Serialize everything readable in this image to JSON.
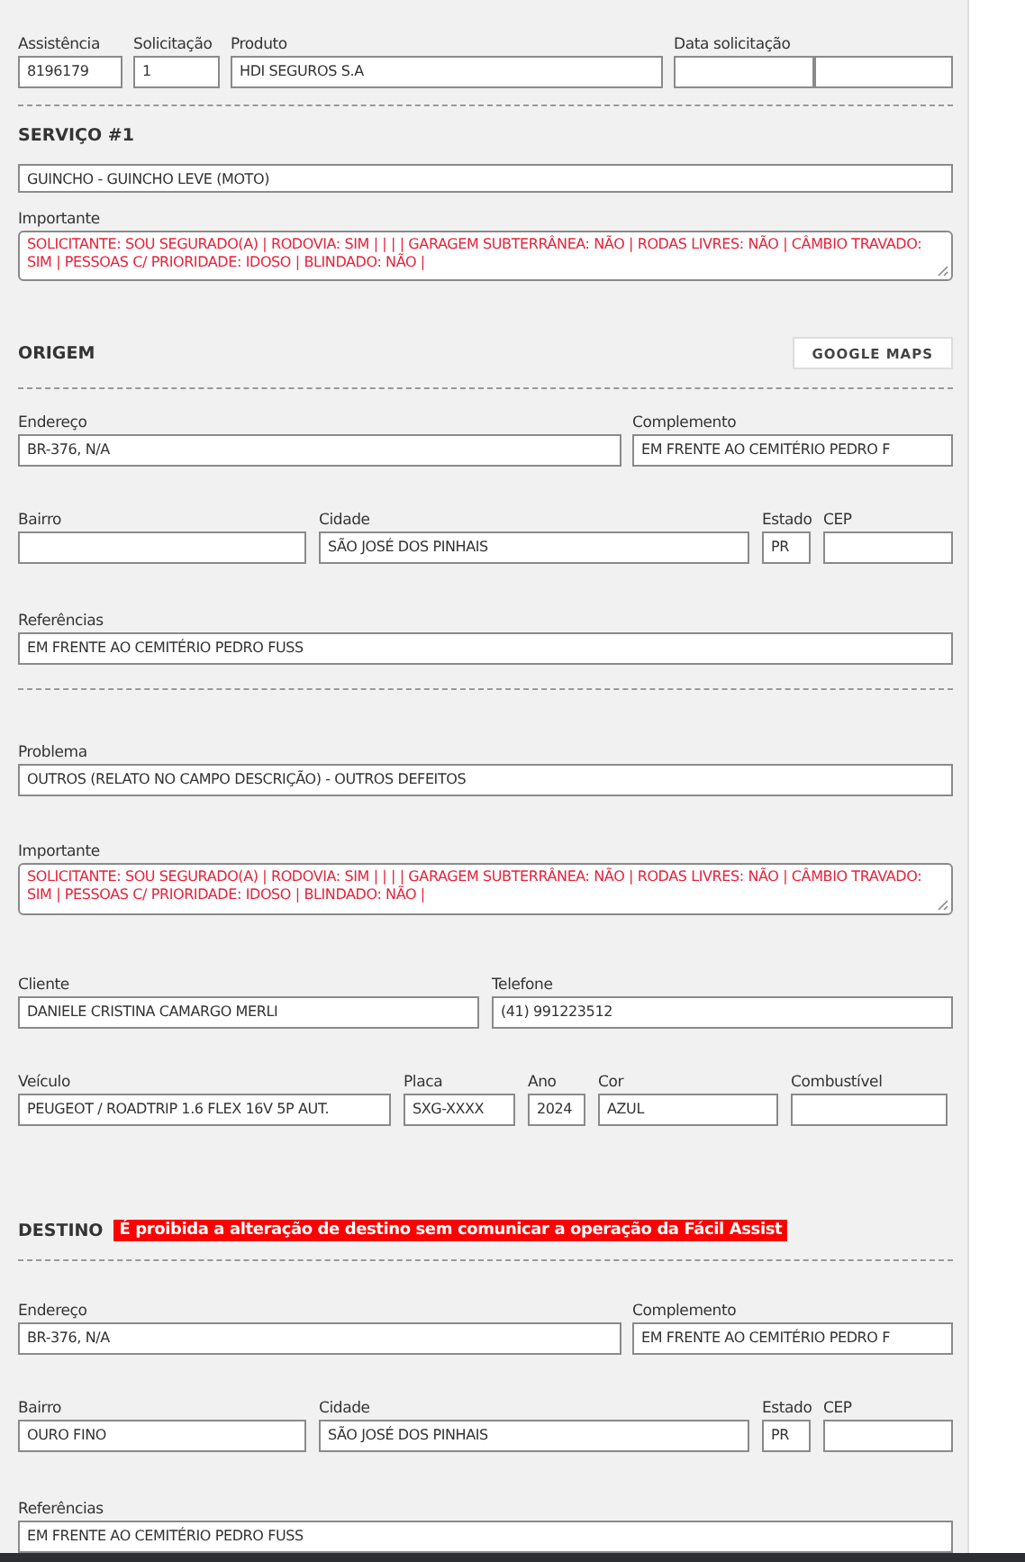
{
  "header": {
    "fields": [
      {
        "kind": "single",
        "label": "Assistência",
        "value": "8196179"
      },
      {
        "kind": "single",
        "label": "Solicitação",
        "value": "1"
      },
      {
        "kind": "single",
        "label": "Produto",
        "value": "HDI SEGUROS S.A"
      },
      {
        "kind": "split",
        "label": "Data solicitação"
      }
    ]
  },
  "servico": {
    "title": "SERVIÇO #1",
    "service": "GUINCHO - GUINCHO LEVE (MOTO)",
    "important_label": "Importante",
    "important_text": "SOLICITANTE: SOU SEGURADO(A) | RODOVIA: SIM |  |  |  | GARAGEM SUBTERRÂNEA: NÃO | RODAS LIVRES: NÃO | CÂMBIO TRAVADO: SIM | PESSOAS C/ PRIORIDADE: IDOSO | BLINDADO: NÃO |"
  },
  "origem": {
    "title": "ORIGEM",
    "maps_button": "GOOGLE MAPS",
    "address": {
      "endereco": {
        "label": "Endereço",
        "value": "BR-376, N/A"
      },
      "complemento": {
        "label": "Complemento",
        "value": "EM FRENTE AO CEMITÉRIO PEDRO F"
      },
      "bairro": {
        "label": "Bairro"
      },
      "cidade": {
        "label": "Cidade",
        "value": "SÃO JOSÉ DOS PINHAIS"
      },
      "estado": {
        "label": "Estado",
        "value": "PR"
      },
      "cep": {
        "label": "CEP"
      },
      "referencias": {
        "label": "Referências",
        "value": "EM FRENTE AO CEMITÉRIO PEDRO FUSS"
      }
    }
  },
  "problema": {
    "label": "Problema",
    "value": "OUTROS (RELATO NO CAMPO DESCRIÇÃO) - OUTROS DEFEITOS",
    "important_label": "Importante",
    "important_text": "SOLICITANTE: SOU SEGURADO(A) | RODOVIA: SIM |  |  |  | GARAGEM SUBTERRÂNEA: NÃO | RODAS LIVRES: NÃO | CÂMBIO TRAVADO: SIM | PESSOAS C/ PRIORIDADE: IDOSO | BLINDADO: NÃO |"
  },
  "cliente": {
    "cliente": {
      "label": "Cliente",
      "value": "DANIELE CRISTINA CAMARGO MERLI"
    },
    "telefone": {
      "label": "Telefone",
      "value": "(41) 991223512"
    },
    "veiculo": {
      "label": "Veículo",
      "value": "PEUGEOT / ROADTRIP 1.6 FLEX 16V 5P AUT."
    },
    "placa": {
      "label": "Placa",
      "value": "SXG-XXXX"
    },
    "ano": {
      "label": "Ano",
      "value": "2024"
    },
    "cor": {
      "label": "Cor",
      "value": "AZUL"
    },
    "combustivel": {
      "label": "Combustível"
    }
  },
  "destino": {
    "title": "DESTINO",
    "warning": "É proibida a alteração de destino sem comunicar a operação da Fácil Assist",
    "address": {
      "endereco": {
        "label": "Endereço",
        "value": "BR-376, N/A"
      },
      "complemento": {
        "label": "Complemento",
        "value": "EM FRENTE AO CEMITÉRIO PEDRO F"
      },
      "bairro": {
        "label": "Bairro",
        "value": "OURO FINO"
      },
      "cidade": {
        "label": "Cidade",
        "value": "SÃO JOSÉ DOS PINHAIS"
      },
      "estado": {
        "label": "Estado",
        "value": "PR"
      },
      "cep": {
        "label": "CEP"
      },
      "referencias": {
        "label": "Referências",
        "value": "EM FRENTE AO CEMITÉRIO PEDRO FUSS"
      }
    }
  }
}
